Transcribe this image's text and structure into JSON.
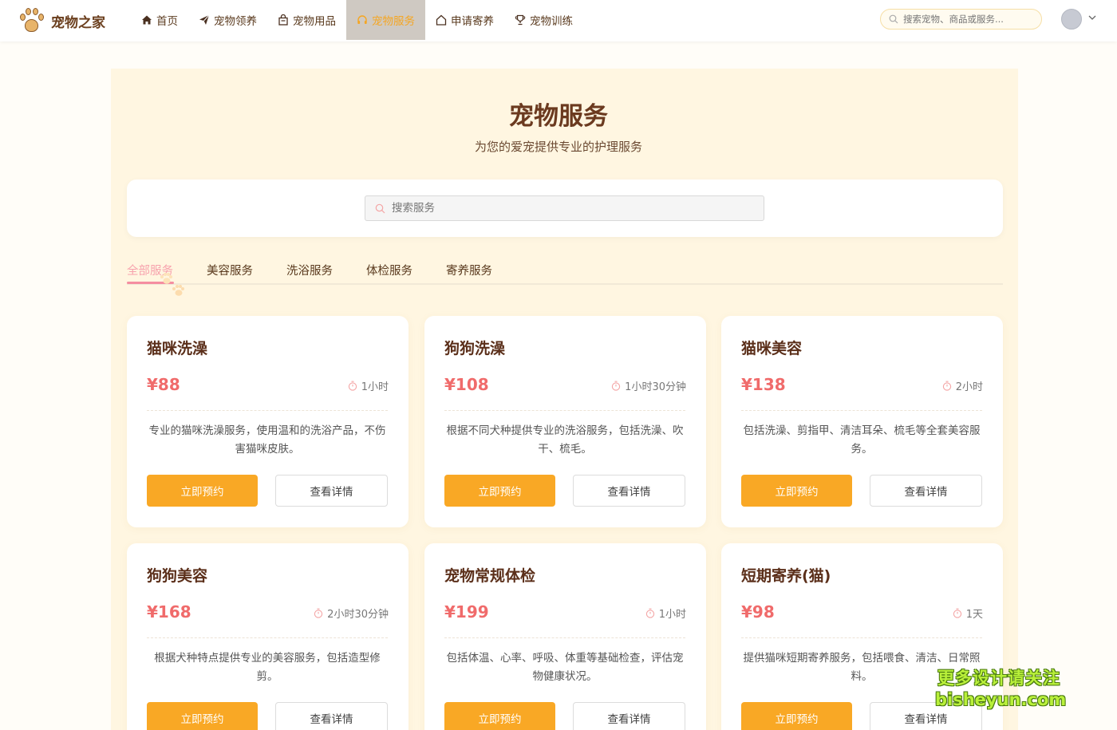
{
  "nav": {
    "brand": "宠物之家",
    "items": [
      {
        "label": "首页",
        "icon": "home-icon"
      },
      {
        "label": "宠物领养",
        "icon": "paper-plane-icon"
      },
      {
        "label": "宠物用品",
        "icon": "shopping-bag-icon"
      },
      {
        "label": "宠物服务",
        "icon": "headset-icon"
      },
      {
        "label": "申请寄养",
        "icon": "house-icon"
      },
      {
        "label": "宠物训练",
        "icon": "trophy-icon"
      }
    ],
    "active_index": 3,
    "search_placeholder": "搜索宠物、商品或服务..."
  },
  "hero": {
    "title": "宠物服务",
    "subtitle": "为您的爱宠提供专业的护理服务"
  },
  "service_search": {
    "placeholder": "搜索服务"
  },
  "tabs": {
    "items": [
      "全部服务",
      "美容服务",
      "洗浴服务",
      "体检服务",
      "寄养服务"
    ],
    "active_index": 0
  },
  "buttons": {
    "book": "立即预约",
    "detail": "查看详情"
  },
  "services": [
    {
      "name": "猫咪洗澡",
      "price": "¥88",
      "duration": "1小时",
      "description": "专业的猫咪洗澡服务，使用温和的洗浴产品，不伤害猫咪皮肤。"
    },
    {
      "name": "狗狗洗澡",
      "price": "¥108",
      "duration": "1小时30分钟",
      "description": "根据不同犬种提供专业的洗浴服务，包括洗澡、吹干、梳毛。"
    },
    {
      "name": "猫咪美容",
      "price": "¥138",
      "duration": "2小时",
      "description": "包括洗澡、剪指甲、清洁耳朵、梳毛等全套美容服务。"
    },
    {
      "name": "狗狗美容",
      "price": "¥168",
      "duration": "2小时30分钟",
      "description": "根据犬种特点提供专业的美容服务，包括造型修剪。"
    },
    {
      "name": "宠物常规体检",
      "price": "¥199",
      "duration": "1小时",
      "description": "包括体温、心率、呼吸、体重等基础检查，评估宠物健康状况。"
    },
    {
      "name": "短期寄养(猫)",
      "price": "¥98",
      "duration": "1天",
      "description": "提供猫咪短期寄养服务，包括喂食、清洁、日常照料。"
    }
  ],
  "colors": {
    "accent": "#f9a825",
    "price": "#f06b6b",
    "active_tab": "#f7a2ad",
    "panel_bg": "#fff6e1"
  },
  "watermark": {
    "line1": "更多设计请关注",
    "line2": "bisheyun.com"
  }
}
